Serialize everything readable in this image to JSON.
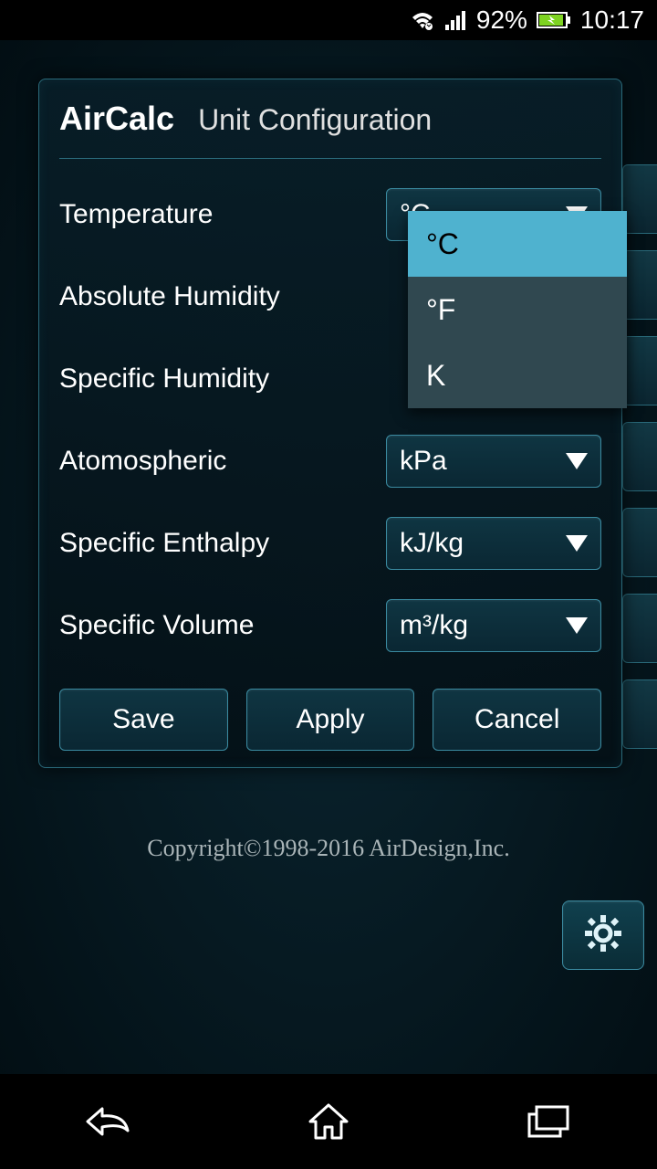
{
  "status": {
    "battery": "92%",
    "time": "10:17"
  },
  "dialog": {
    "title": "AirCalc",
    "subtitle": "Unit Configuration",
    "rows": {
      "temperature": {
        "label": "Temperature",
        "value": "°C"
      },
      "absHumidity": {
        "label": "Absolute Humidity",
        "value": ""
      },
      "specHumidity": {
        "label": "Specific Humidity",
        "value": ""
      },
      "atmospheric": {
        "label": "Atomospheric",
        "value": "kPa"
      },
      "specEnthalpy": {
        "label": "Specific Enthalpy",
        "value": "kJ/kg"
      },
      "specVolume": {
        "label": "Specific Volume",
        "value": "m³/kg"
      }
    },
    "dropdown": {
      "options": {
        "c": "°C",
        "f": "°F",
        "k": "K"
      }
    },
    "buttons": {
      "save": "Save",
      "apply": "Apply",
      "cancel": "Cancel"
    }
  },
  "copyright": "Copyright©1998-2016 AirDesign,Inc."
}
